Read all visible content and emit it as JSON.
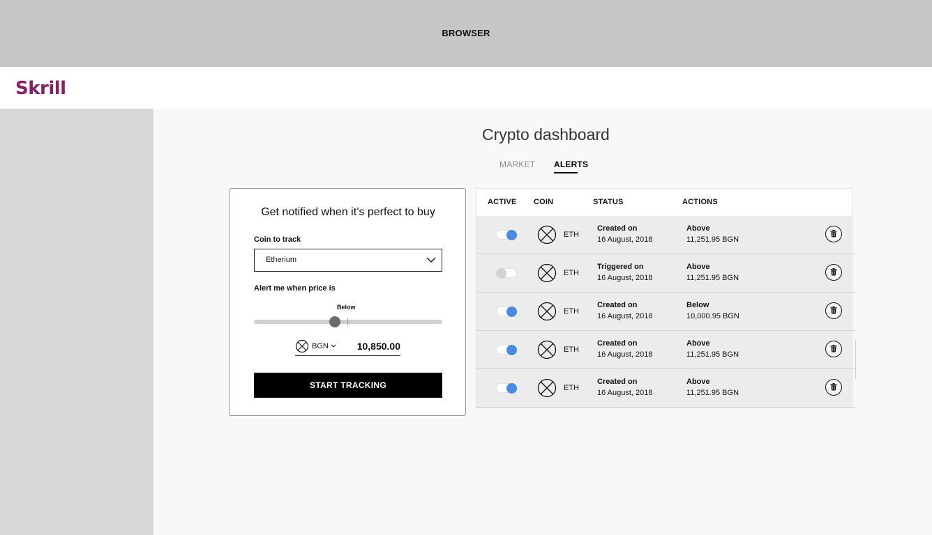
{
  "browser": {
    "title": "BROWSER"
  },
  "brand": {
    "logo": "Skrill",
    "color": "#862165"
  },
  "page": {
    "title": "Crypto dashboard"
  },
  "tabs": [
    {
      "label": "MARKET",
      "active": false
    },
    {
      "label": "ALERTS",
      "active": true
    }
  ],
  "form": {
    "title": "Get notified when it’s perfect to buy",
    "coin_label": "Coin to track",
    "coin_value": "Etherium",
    "alert_label": "Alert me when price is",
    "direction": "Below",
    "slider_fraction": 0.43,
    "currency": "BGN",
    "amount": "10,850.00",
    "button": "START TRACKING"
  },
  "table": {
    "headers": {
      "active": "ACTIVE",
      "coin": "COIN",
      "status": "STATUS",
      "actions": "ACTIONS"
    },
    "rows": [
      {
        "active": true,
        "coin": "ETH",
        "status": "Created on",
        "date": "16 August, 2018",
        "direction": "Above",
        "value": "11,251.95 BGN"
      },
      {
        "active": false,
        "coin": "ETH",
        "status": "Triggered on",
        "date": "16 August, 2018",
        "direction": "Above",
        "value": "11,251.95 BGN"
      },
      {
        "active": true,
        "coin": "ETH",
        "status": "Created on",
        "date": "16 August, 2018",
        "direction": "Below",
        "value": "10,000.95 BGN"
      },
      {
        "active": true,
        "coin": "ETH",
        "status": "Created on",
        "date": "16 August, 2018",
        "direction": "Above",
        "value": "11,251.95 BGN"
      },
      {
        "active": true,
        "coin": "ETH",
        "status": "Created on",
        "date": "16 August, 2018",
        "direction": "Above",
        "value": "11,251.95 BGN"
      }
    ]
  },
  "colors": {
    "toggle_on": "#4a8ae2",
    "toggle_off": "#d2d2d2",
    "button_bg": "#000000"
  },
  "icons": {
    "coin": "crossed-circle-icon",
    "delete": "trash-icon",
    "dropdown": "chevron-down-icon"
  }
}
